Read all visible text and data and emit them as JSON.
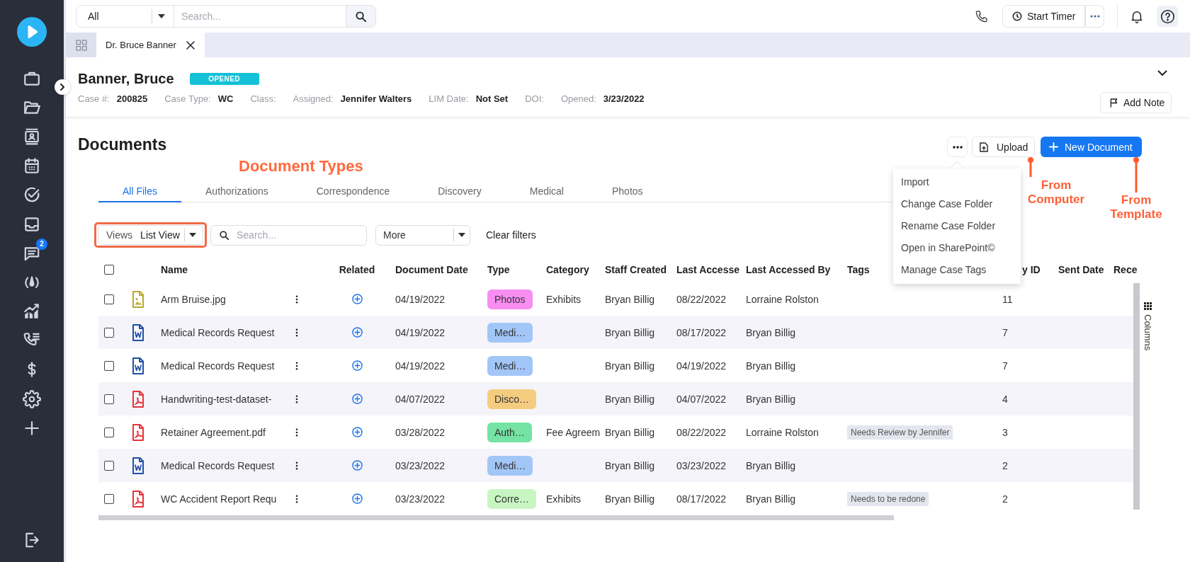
{
  "sidebar": {
    "notification_badge": "2"
  },
  "top_bar": {
    "scope_select": "All",
    "search_placeholder": "Search...",
    "timer_button": "Start Timer"
  },
  "record_tabs": [
    {
      "label": "Dr. Bruce Banner",
      "selected": true
    }
  ],
  "case_header": {
    "name": "Banner, Bruce",
    "status": "OPENED",
    "fields": [
      {
        "label": "Case #:",
        "value": "200825"
      },
      {
        "label": "Case Type:",
        "value": "WC"
      },
      {
        "label": "Class:"
      },
      {
        "label": "Assigned:",
        "value": "Jennifer Walters"
      },
      {
        "label": "LIM Date:",
        "value": "Not Set"
      },
      {
        "label": "DOI:"
      },
      {
        "label": "Opened:",
        "value": "3/23/2022"
      }
    ],
    "add_note_button": "Add Note"
  },
  "documents": {
    "title": "Documents",
    "upload_button": "Upload",
    "new_document_button": "New Document",
    "more_menu": {
      "items": [
        "Import",
        "Change Case Folder",
        "Rename Case Folder",
        "Open in SharePoint©",
        "Manage Case Tags"
      ]
    },
    "tabs": [
      {
        "label": "All Files",
        "selected": true
      },
      {
        "label": "Authorizations",
        "selected": false
      },
      {
        "label": "Correspondence",
        "selected": false
      },
      {
        "label": "Discovery",
        "selected": false
      },
      {
        "label": "Medical",
        "selected": false
      },
      {
        "label": "Photos",
        "selected": false
      }
    ],
    "toolbar": {
      "views_label": "Views",
      "view_value": "List View",
      "search_placeholder": "Search...",
      "more_select": "More",
      "clear_filters": "Clear filters"
    },
    "table": {
      "select_all_checked": false,
      "columns": [
        "Name",
        "Related",
        "Document Date",
        "Type",
        "Category",
        "Staff Created",
        "Last Accesse",
        "Last Accessed By",
        "Tags",
        "y ID",
        "Sent Date",
        "Rece"
      ],
      "rows": [
        {
          "checked": false,
          "kind": "image",
          "name": "Arm Bruise.jpg",
          "document_date": "04/19/2022",
          "type": {
            "label": "Photos",
            "color": "#f98ef2"
          },
          "category": "Exhibits",
          "staff_created": "Bryan Billig",
          "column_7": "08/22/2022",
          "last_accessed_by": "Lorraine Rolston",
          "column_10": "11"
        },
        {
          "checked": false,
          "kind": "word",
          "name": "Medical Records Request",
          "document_date": "04/19/2022",
          "type": {
            "label": "Medi…",
            "color": "#a3c6f8"
          },
          "staff_created": "Bryan Billig",
          "column_7": "08/17/2022",
          "last_accessed_by": "Bryan Billig",
          "column_10": "7"
        },
        {
          "checked": false,
          "kind": "word",
          "name": "Medical Records Request",
          "document_date": "04/19/2022",
          "type": {
            "label": "Medi…",
            "color": "#a3c6f8"
          },
          "staff_created": "Bryan Billig",
          "column_7": "04/19/2022",
          "last_accessed_by": "Bryan Billig",
          "column_10": "7"
        },
        {
          "checked": false,
          "kind": "pdf",
          "name": "Handwriting-test-dataset-",
          "document_date": "04/07/2022",
          "type": {
            "label": "Disco…",
            "color": "#f4cc80"
          },
          "staff_created": "Bryan Billig",
          "column_7": "04/07/2022",
          "last_accessed_by": "Bryan Billig",
          "column_10": "4"
        },
        {
          "checked": false,
          "kind": "pdf",
          "name": "Retainer Agreement.pdf",
          "document_date": "03/28/2022",
          "type": {
            "label": "Auth…",
            "color": "#74e3a4"
          },
          "category": "Fee Agreem",
          "staff_created": "Bryan Billig",
          "column_7": "08/22/2022",
          "last_accessed_by": "Lorraine Rolston",
          "tags": [
            "Needs Review by Jennifer"
          ],
          "column_10": "3"
        },
        {
          "checked": false,
          "kind": "word",
          "name": "Medical Records Request",
          "document_date": "03/23/2022",
          "type": {
            "label": "Medi…",
            "color": "#a3c6f8"
          },
          "staff_created": "Bryan Billig",
          "column_7": "03/23/2022",
          "last_accessed_by": "Bryan Billig",
          "column_10": "2"
        },
        {
          "checked": false,
          "kind": "pdf",
          "name": "WC Accident Report Requ",
          "document_date": "03/23/2022",
          "type": {
            "label": "Corre…",
            "color": "#c8f5c2"
          },
          "category": "Exhibits",
          "staff_created": "Bryan Billig",
          "column_7": "08/17/2022",
          "last_accessed_by": "Bryan Billig",
          "tags": [
            "Needs to be redone"
          ],
          "column_10": "2"
        }
      ]
    },
    "columns_panel": "Columns"
  },
  "annotations": {
    "views_frame": true,
    "document_types": "Document Types",
    "upload_note": "From Computer",
    "new_document_note": "From Template"
  }
}
